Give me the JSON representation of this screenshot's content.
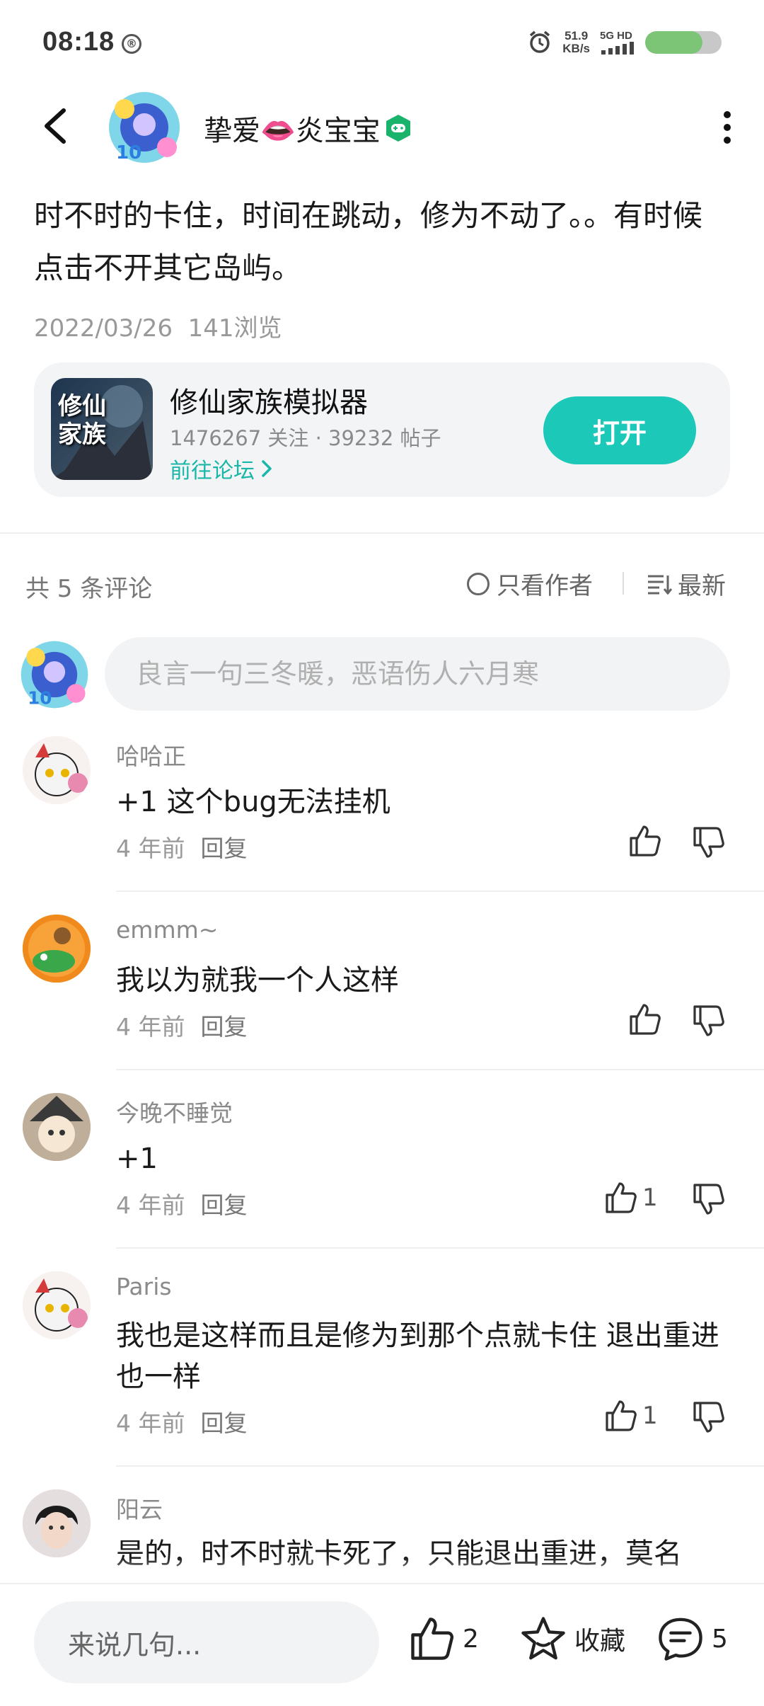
{
  "status_bar": {
    "time": "08:18",
    "status_icon_glyph": "®",
    "net_speed_value": "51.9",
    "net_speed_unit": "KB/s",
    "signal_label": "5G HD",
    "battery_level_percent": 75
  },
  "header": {
    "user_name": "挚爱👄炎宝宝",
    "badge_icon": "gamepad-badge-icon"
  },
  "post": {
    "text": "时不时的卡住，时间在跳动，修为不动了。。有时候点击不开其它岛屿。",
    "date": "2022/03/26",
    "views": "141浏览"
  },
  "game_card": {
    "icon_text": "修仙家族",
    "name": "修仙家族模拟器",
    "stats": "1476267 关注 · 39232 帖子",
    "forum_link": "前往论坛",
    "open_button": "打开"
  },
  "comments_section": {
    "count_label": "共 5 条评论",
    "author_only_label": "只看作者",
    "sort_label": "最新",
    "input_placeholder": "良言一句三冬暖，恶语伤人六月寒"
  },
  "comments": [
    {
      "user": "哈哈正",
      "text": "+1 这个bug无法挂机",
      "time": "4 年前",
      "reply": "回复",
      "likes": ""
    },
    {
      "user": "emmm~",
      "text": "我以为就我一个人这样",
      "time": "4 年前",
      "reply": "回复",
      "likes": ""
    },
    {
      "user": "今晚不睡觉",
      "text": " +1",
      "time": "4 年前",
      "reply": "回复",
      "likes": "1"
    },
    {
      "user": "Paris",
      "text": "我也是这样而且是修为到那个点就卡住 退出重进也一样",
      "time": "4 年前",
      "reply": "回复",
      "likes": "1"
    },
    {
      "user": "阳云",
      "text": "是的，时不时就卡死了，只能退出重进，莫名",
      "time": "",
      "reply": "",
      "likes": ""
    }
  ],
  "bottom_bar": {
    "input_placeholder": "来说几句...",
    "like_count": "2",
    "favorite_label": "收藏",
    "comment_count": "5"
  },
  "colors": {
    "accent": "#1cc8b8",
    "forum_link": "#19b7a8",
    "battery": "#7cc576"
  }
}
